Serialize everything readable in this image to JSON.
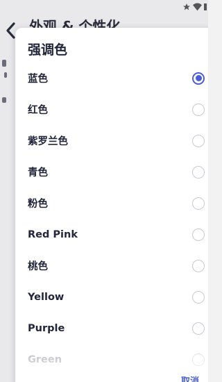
{
  "background": {
    "title": "外观 & 个性化"
  },
  "dialog": {
    "title": "强调色",
    "options": [
      {
        "label": "蓝色",
        "selected": true
      },
      {
        "label": "红色",
        "selected": false
      },
      {
        "label": "紫罗兰色",
        "selected": false
      },
      {
        "label": "青色",
        "selected": false
      },
      {
        "label": "粉色",
        "selected": false
      },
      {
        "label": "Red Pink",
        "selected": false
      },
      {
        "label": "桃色",
        "selected": false
      },
      {
        "label": "Yellow",
        "selected": false
      },
      {
        "label": "Purple",
        "selected": false
      },
      {
        "label": "Green",
        "selected": false
      }
    ],
    "cancel_label": "取消"
  },
  "colors": {
    "accent": "#4a5ed3"
  },
  "icons": {
    "status": [
      "star-icon",
      "wifi-icon"
    ],
    "nav": "back-arrow-icon"
  }
}
